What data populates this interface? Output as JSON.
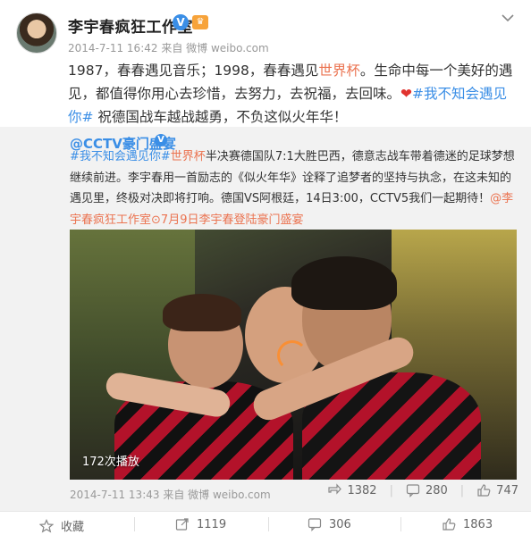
{
  "post": {
    "author": "李宇春疯狂工作室",
    "meta": "2014-7-11 16:42 来自 微博 weibo.com",
    "text_1": "1987，春春遇见音乐；1998，春春遇见",
    "link_1": "世界杯",
    "text_2": "。生命中每一个美好的遇见，都值得你用心去珍惜，去努力，去祝福，去回味。",
    "heart": "❤",
    "tag": "#我不知会遇见你#",
    "text_3": " 祝德国战车越战越勇，不负这似火年华！"
  },
  "repost": {
    "author": "@CCTV豪门盛宴",
    "tag": "#我不知会遇见你#",
    "link_1": "世界杯",
    "text_1": "半决赛德国队7:1大胜巴西，德意志战车带着德迷的足球梦想继续前进。李宇春用一首励志的《似火年华》诠释了追梦者的坚持与执念，在这未知的遇见里，终极对决即将打响。德国VS阿根廷，14日3:00，CCTV5我们一起期待！",
    "mention": "@李宇春疯狂工作室",
    "video_link": "7月9日李宇春登陆豪门盛宴",
    "video_views": "172次播放",
    "meta": "2014-7-11 13:43 来自 微博 weibo.com",
    "forward_count": "1382",
    "comment_count": "280",
    "like_count": "747"
  },
  "actions": {
    "favorite": "收藏",
    "forward": "1119",
    "comment": "306",
    "like": "1863"
  },
  "colors": {
    "link_orange": "#eb7350",
    "tag_blue": "#3a8ee6",
    "repost_bg": "#f2f2f2",
    "badge_blue": "#3a8ee6",
    "badge_gold": "#f7a33a"
  }
}
